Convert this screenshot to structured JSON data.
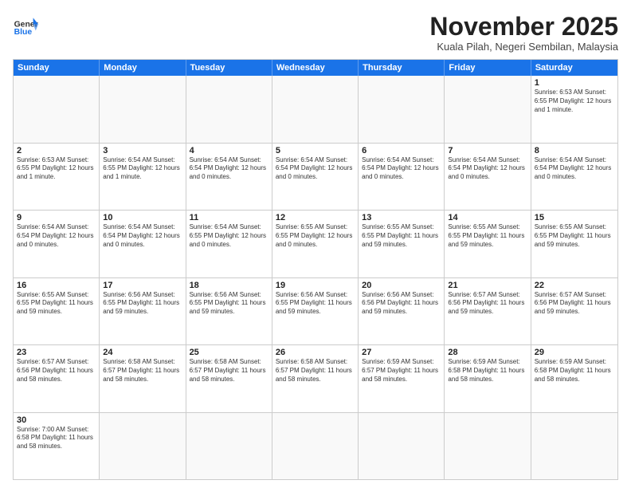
{
  "header": {
    "logo_general": "General",
    "logo_blue": "Blue",
    "title": "November 2025",
    "location": "Kuala Pilah, Negeri Sembilan, Malaysia"
  },
  "weekdays": [
    "Sunday",
    "Monday",
    "Tuesday",
    "Wednesday",
    "Thursday",
    "Friday",
    "Saturday"
  ],
  "rows": [
    [
      {
        "day": "",
        "text": ""
      },
      {
        "day": "",
        "text": ""
      },
      {
        "day": "",
        "text": ""
      },
      {
        "day": "",
        "text": ""
      },
      {
        "day": "",
        "text": ""
      },
      {
        "day": "",
        "text": ""
      },
      {
        "day": "1",
        "text": "Sunrise: 6:53 AM\nSunset: 6:55 PM\nDaylight: 12 hours\nand 1 minute."
      }
    ],
    [
      {
        "day": "2",
        "text": "Sunrise: 6:53 AM\nSunset: 6:55 PM\nDaylight: 12 hours\nand 1 minute."
      },
      {
        "day": "3",
        "text": "Sunrise: 6:54 AM\nSunset: 6:55 PM\nDaylight: 12 hours\nand 1 minute."
      },
      {
        "day": "4",
        "text": "Sunrise: 6:54 AM\nSunset: 6:54 PM\nDaylight: 12 hours\nand 0 minutes."
      },
      {
        "day": "5",
        "text": "Sunrise: 6:54 AM\nSunset: 6:54 PM\nDaylight: 12 hours\nand 0 minutes."
      },
      {
        "day": "6",
        "text": "Sunrise: 6:54 AM\nSunset: 6:54 PM\nDaylight: 12 hours\nand 0 minutes."
      },
      {
        "day": "7",
        "text": "Sunrise: 6:54 AM\nSunset: 6:54 PM\nDaylight: 12 hours\nand 0 minutes."
      },
      {
        "day": "8",
        "text": "Sunrise: 6:54 AM\nSunset: 6:54 PM\nDaylight: 12 hours\nand 0 minutes."
      }
    ],
    [
      {
        "day": "9",
        "text": "Sunrise: 6:54 AM\nSunset: 6:54 PM\nDaylight: 12 hours\nand 0 minutes."
      },
      {
        "day": "10",
        "text": "Sunrise: 6:54 AM\nSunset: 6:54 PM\nDaylight: 12 hours\nand 0 minutes."
      },
      {
        "day": "11",
        "text": "Sunrise: 6:54 AM\nSunset: 6:55 PM\nDaylight: 12 hours\nand 0 minutes."
      },
      {
        "day": "12",
        "text": "Sunrise: 6:55 AM\nSunset: 6:55 PM\nDaylight: 12 hours\nand 0 minutes."
      },
      {
        "day": "13",
        "text": "Sunrise: 6:55 AM\nSunset: 6:55 PM\nDaylight: 11 hours\nand 59 minutes."
      },
      {
        "day": "14",
        "text": "Sunrise: 6:55 AM\nSunset: 6:55 PM\nDaylight: 11 hours\nand 59 minutes."
      },
      {
        "day": "15",
        "text": "Sunrise: 6:55 AM\nSunset: 6:55 PM\nDaylight: 11 hours\nand 59 minutes."
      }
    ],
    [
      {
        "day": "16",
        "text": "Sunrise: 6:55 AM\nSunset: 6:55 PM\nDaylight: 11 hours\nand 59 minutes."
      },
      {
        "day": "17",
        "text": "Sunrise: 6:56 AM\nSunset: 6:55 PM\nDaylight: 11 hours\nand 59 minutes."
      },
      {
        "day": "18",
        "text": "Sunrise: 6:56 AM\nSunset: 6:55 PM\nDaylight: 11 hours\nand 59 minutes."
      },
      {
        "day": "19",
        "text": "Sunrise: 6:56 AM\nSunset: 6:55 PM\nDaylight: 11 hours\nand 59 minutes."
      },
      {
        "day": "20",
        "text": "Sunrise: 6:56 AM\nSunset: 6:56 PM\nDaylight: 11 hours\nand 59 minutes."
      },
      {
        "day": "21",
        "text": "Sunrise: 6:57 AM\nSunset: 6:56 PM\nDaylight: 11 hours\nand 59 minutes."
      },
      {
        "day": "22",
        "text": "Sunrise: 6:57 AM\nSunset: 6:56 PM\nDaylight: 11 hours\nand 59 minutes."
      }
    ],
    [
      {
        "day": "23",
        "text": "Sunrise: 6:57 AM\nSunset: 6:56 PM\nDaylight: 11 hours\nand 58 minutes."
      },
      {
        "day": "24",
        "text": "Sunrise: 6:58 AM\nSunset: 6:57 PM\nDaylight: 11 hours\nand 58 minutes."
      },
      {
        "day": "25",
        "text": "Sunrise: 6:58 AM\nSunset: 6:57 PM\nDaylight: 11 hours\nand 58 minutes."
      },
      {
        "day": "26",
        "text": "Sunrise: 6:58 AM\nSunset: 6:57 PM\nDaylight: 11 hours\nand 58 minutes."
      },
      {
        "day": "27",
        "text": "Sunrise: 6:59 AM\nSunset: 6:57 PM\nDaylight: 11 hours\nand 58 minutes."
      },
      {
        "day": "28",
        "text": "Sunrise: 6:59 AM\nSunset: 6:58 PM\nDaylight: 11 hours\nand 58 minutes."
      },
      {
        "day": "29",
        "text": "Sunrise: 6:59 AM\nSunset: 6:58 PM\nDaylight: 11 hours\nand 58 minutes."
      }
    ],
    [
      {
        "day": "30",
        "text": "Sunrise: 7:00 AM\nSunset: 6:58 PM\nDaylight: 11 hours\nand 58 minutes."
      },
      {
        "day": "",
        "text": ""
      },
      {
        "day": "",
        "text": ""
      },
      {
        "day": "",
        "text": ""
      },
      {
        "day": "",
        "text": ""
      },
      {
        "day": "",
        "text": ""
      },
      {
        "day": "",
        "text": ""
      }
    ]
  ]
}
